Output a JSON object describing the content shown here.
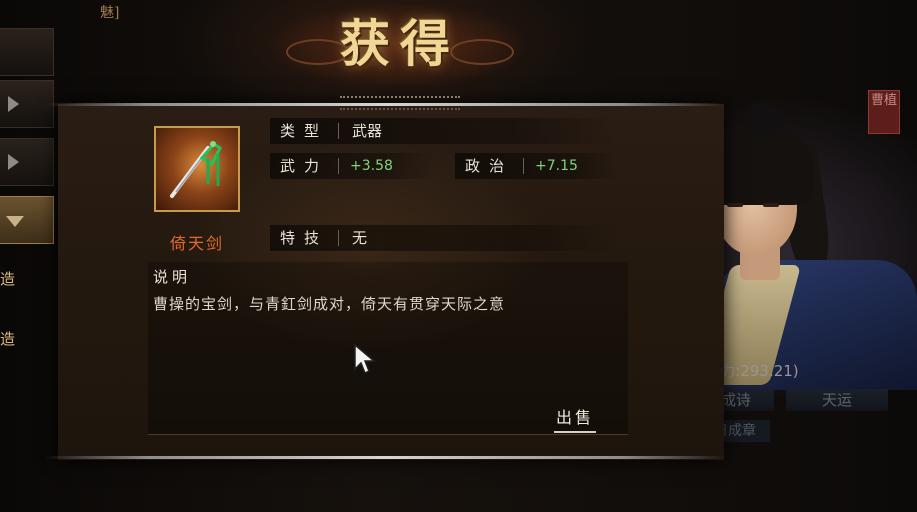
{
  "background": {
    "topleft_text": "魅]",
    "side_chars": [
      "造",
      "造"
    ],
    "seal_text": "曹植",
    "stats_text": "148.49 魅力:293.21)",
    "buttons": [
      "七步成诗",
      "天运"
    ],
    "button2": "日成章"
  },
  "dialog": {
    "title": "获得",
    "item": {
      "icon": "sword-icon",
      "name": "倚天剑"
    },
    "attributes": {
      "type_label": "类型",
      "type_value": "武器",
      "force_label": "武力",
      "force_value": "+3.58",
      "politics_label": "政治",
      "politics_value": "+7.15",
      "skill_label": "特技",
      "skill_value": "无"
    },
    "description": {
      "label": "说明",
      "text": "曹操的宝剑，与青釭剑成对，倚天有贯穿天际之意"
    },
    "sell_label": "出售"
  },
  "colors": {
    "title_gold": "#f0d795",
    "item_name_orange": "#e26a2c",
    "stat_green": "#7fd67a",
    "icon_border": "#c89a4e"
  }
}
